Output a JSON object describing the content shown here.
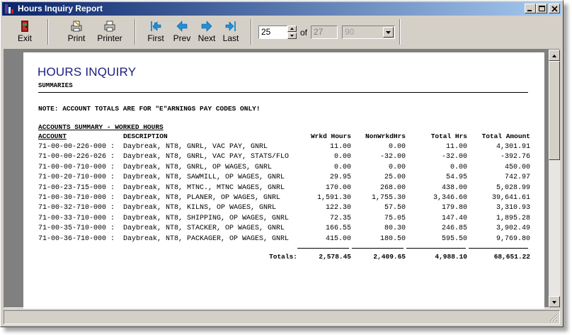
{
  "window": {
    "title": "Hours Inquiry Report"
  },
  "toolbar": {
    "exit": "Exit",
    "print": "Print",
    "printer": "Printer",
    "first": "First",
    "prev": "Prev",
    "next": "Next",
    "last": "Last",
    "page_value": "25",
    "of_label": "of",
    "total_pages": "27",
    "zoom_value": "90"
  },
  "report": {
    "title": "HOURS INQUIRY",
    "subtitle": "SUMMARIES",
    "note": "NOTE: ACCOUNT TOTALS ARE FOR \"E\"ARNINGS PAY CODES ONLY!",
    "section": "ACCOUNTS SUMMARY - WORKED HOURS",
    "headers": {
      "account": "ACCOUNT",
      "description": "DESCRIPTION",
      "worked": "Wrkd Hours",
      "nonworked": "NonWrkdHrs",
      "total_hrs": "Total Hrs",
      "total_amt": "Total Amount"
    },
    "rows": [
      {
        "account": "71-00-00-226-000 :",
        "description": "Daybreak, NT8, GNRL, VAC PAY, GNRL",
        "worked": "11.00",
        "nonworked": "0.00",
        "total_hrs": "11.00",
        "total_amt": "4,301.91"
      },
      {
        "account": "71-00-00-226-026 :",
        "description": "Daybreak, NT8, GNRL, VAC PAY, STATS/FLO",
        "worked": "0.00",
        "nonworked": "-32.00",
        "total_hrs": "-32.00",
        "total_amt": "-392.76"
      },
      {
        "account": "71-00-00-710-000 :",
        "description": "Daybreak, NT8, GNRL, OP WAGES, GNRL",
        "worked": "0.00",
        "nonworked": "0.00",
        "total_hrs": "0.00",
        "total_amt": "450.00"
      },
      {
        "account": "71-00-20-710-000 :",
        "description": "Daybreak, NT8, SAWMILL, OP WAGES, GNRL",
        "worked": "29.95",
        "nonworked": "25.00",
        "total_hrs": "54.95",
        "total_amt": "742.97"
      },
      {
        "account": "71-00-23-715-000 :",
        "description": "Daybreak, NT8, MTNC., MTNC WAGES, GNRL",
        "worked": "170.00",
        "nonworked": "268.00",
        "total_hrs": "438.00",
        "total_amt": "5,028.99"
      },
      {
        "account": "71-00-30-710-000 :",
        "description": "Daybreak, NT8, PLANER, OP WAGES, GNRL",
        "worked": "1,591.30",
        "nonworked": "1,755.30",
        "total_hrs": "3,346.60",
        "total_amt": "39,641.61"
      },
      {
        "account": "71-00-32-710-000 :",
        "description": "Daybreak, NT8, KILNS, OP WAGES, GNRL",
        "worked": "122.30",
        "nonworked": "57.50",
        "total_hrs": "179.80",
        "total_amt": "3,310.93"
      },
      {
        "account": "71-00-33-710-000 :",
        "description": "Daybreak, NT8, SHIPPING, OP WAGES, GNRL",
        "worked": "72.35",
        "nonworked": "75.05",
        "total_hrs": "147.40",
        "total_amt": "1,895.28"
      },
      {
        "account": "71-00-35-710-000 :",
        "description": "Daybreak, NT8, STACKER, OP WAGES, GNRL",
        "worked": "166.55",
        "nonworked": "80.30",
        "total_hrs": "246.85",
        "total_amt": "3,902.49"
      },
      {
        "account": "71-00-36-710-000 :",
        "description": "Daybreak, NT8, PACKAGER, OP WAGES, GNRL",
        "worked": "415.00",
        "nonworked": "180.50",
        "total_hrs": "595.50",
        "total_amt": "9,769.80"
      }
    ],
    "totals": {
      "label": "Totals:",
      "worked": "2,578.45",
      "nonworked": "2,409.65",
      "total_hrs": "4,988.10",
      "total_amt": "68,651.22"
    }
  },
  "icons": {
    "exit": "exit-door-icon",
    "print": "print-icon",
    "printer": "printer-setup-icon",
    "first": "first-page-icon",
    "prev": "prev-page-icon",
    "next": "next-page-icon",
    "last": "last-page-icon"
  },
  "colors": {
    "titlebar_start": "#0a246a",
    "titlebar_end": "#a6caf0",
    "nav_arrow": "#1e8fd8",
    "report_title": "#1a2080"
  }
}
